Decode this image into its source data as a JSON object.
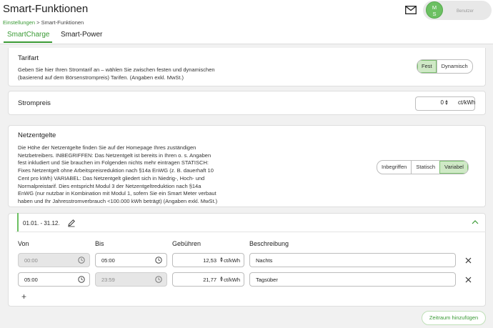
{
  "header": {
    "title": "Smart-Funktionen",
    "breadcrumb": {
      "parent": "Einstellungen",
      "separator": ">",
      "current": "Smart-Funktionen"
    },
    "user": {
      "initials_line1": "M",
      "initials_line2": "S",
      "name": "Benutzer"
    },
    "mail_icon": "mail-icon",
    "tabs": [
      {
        "label": "SmartCharge",
        "active": true
      },
      {
        "label": "Smart-Power",
        "active": false
      }
    ]
  },
  "tarifart": {
    "title": "Tarifart",
    "description_line1": "Geben Sie hier Ihren Stromtarif an – wählen Sie zwischen festen und dynamischen",
    "description_line2": "(basierend auf dem Börsenstrompreis) Tarifen. (Angaben exkl. MwSt.)",
    "options": [
      "Fest",
      "Dynamisch"
    ],
    "selected": "Fest"
  },
  "strompreis": {
    "title": "Strompreis",
    "value": "0",
    "unit": "ct/kWh"
  },
  "netzentgelte": {
    "title": "Netzentgelte",
    "description_lines": [
      "Die Höhe der Netzentgelte finden Sie auf der Homepage Ihres zuständigen",
      "Netzbetreibers. INBEGRIFFEN: Das Netzentgelt ist bereits in Ihren o. s. Angaben",
      "fest inkludiert und Sie brauchen im Folgenden nichts mehr eintragen STATISCH:",
      "Fixes Netzentgelt ohne Arbeitspreisreduktion nach §14a EnWG (z. B. dauerhaft 10",
      "Cent pro kWh) VARIABEL: Das Netzentgelt gliedert sich in Niedrig-, Hoch- und",
      "Normalpreistarif. Dies entspricht Modul 3 der Netzentgeltreduktion nach §14a",
      "EnWG (nur nutzbar in Kombination mit Modul 1, sofern Sie ein Smart Meter verbaut",
      "haben und Ihr Jahresstromverbrauch <100.000 kWh beträgt) (Angaben exkl. MwSt.)"
    ],
    "options": [
      "Inbegriffen",
      "Statisch",
      "Variabel"
    ],
    "selected": "Variabel"
  },
  "zeitraum": {
    "range": "01.01. - 31.12.",
    "columns": {
      "von": "Von",
      "bis": "Bis",
      "gebuehren": "Gebühren",
      "beschreibung": "Beschreibung"
    },
    "rows": [
      {
        "von": "00:00",
        "von_disabled": true,
        "bis": "05:00",
        "bis_disabled": false,
        "gebuehr": "12,53",
        "unit": "ct/kWh",
        "beschreibung": "Nachts"
      },
      {
        "von": "05:00",
        "von_disabled": false,
        "bis": "23:59",
        "bis_disabled": true,
        "gebuehr": "21,77",
        "unit": "ct/kWh",
        "beschreibung": "Tagsüber"
      }
    ],
    "add_row": "+",
    "add_button": "Zeitraum hinzufügen"
  },
  "colors": {
    "accent": "#3a9a35",
    "selected_bg": "#cfe9c6",
    "avatar": "#6cc062"
  }
}
